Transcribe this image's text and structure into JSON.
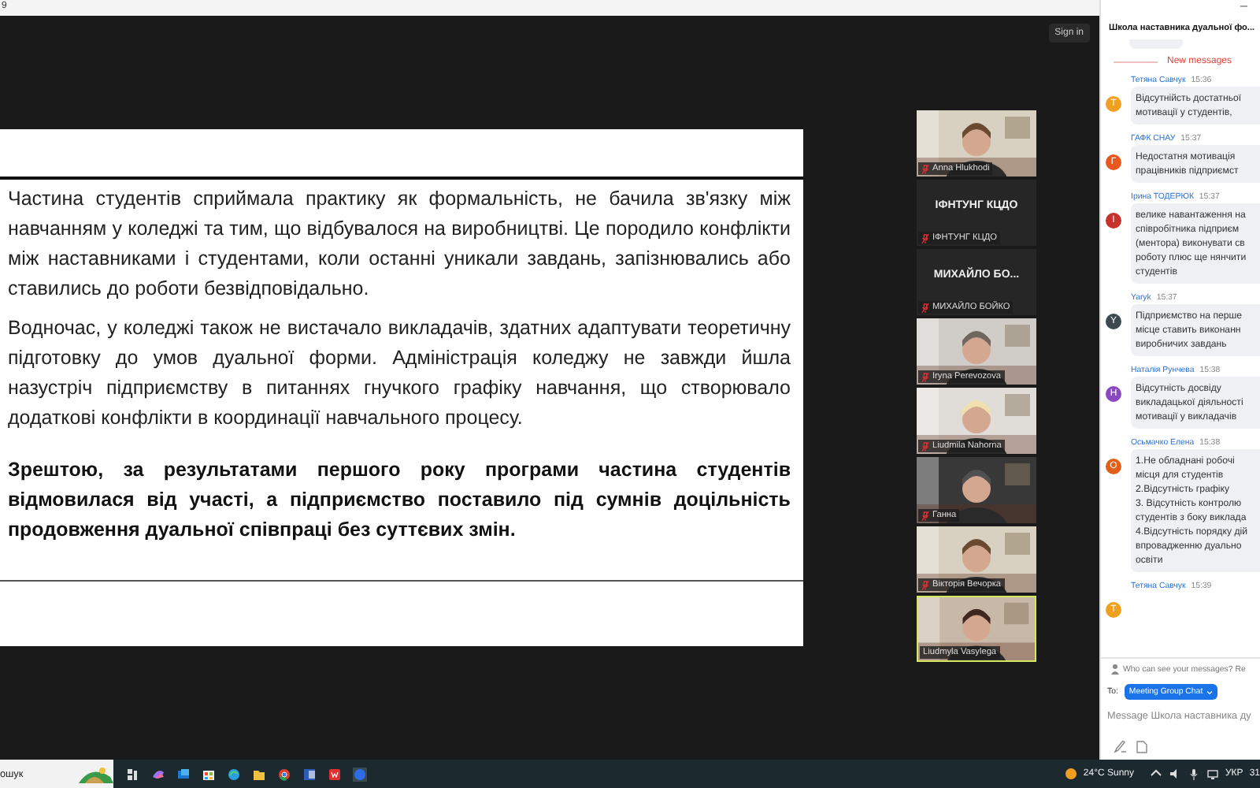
{
  "corner_text": "9",
  "sign_in": "Sign in",
  "slide": {
    "paragraphs": [
      {
        "text": "Частина студентів сприймала практику як формальність, не бачила зв'язку між навчанням у коледжі та тим, що відбувалося на виробництві. Це породило конфлікти між наставниками і студентами, коли останні уникали завдань, запізнювались або ставились до роботи безвідповідально.",
        "bold": false
      },
      {
        "text": "Водночас, у коледжі також не вистачало викладачів, здатних адаптувати теоретичну підготовку до умов дуальної форми. Адміністрація коледжу не завжди йшла назустріч підприємству в питаннях гнучкого графіку навчання, що створювало додаткові конфлікти в координації навчального процесу.",
        "bold": false
      },
      {
        "text": "Зрештою, за результатами першого року програми частина студентів відмовилася від участі, а підприємство поставило під сумнів доцільність продовження дуальної співпраці без суттєвих змін.",
        "bold": true
      }
    ]
  },
  "participants": [
    {
      "kind": "video",
      "name": "Anna Hlukhodi",
      "muted": true,
      "speaking": false
    },
    {
      "kind": "name",
      "display": "ІФНТУНГ КЦДО",
      "name": "ІФНТУНГ КЦДО",
      "muted": true,
      "speaking": false
    },
    {
      "kind": "name",
      "display": "МИХАЙЛО БО...",
      "name": "МИХАЙЛО БОЙКО",
      "muted": true,
      "speaking": false
    },
    {
      "kind": "video",
      "name": "Iryna Perevozova",
      "muted": true,
      "speaking": false
    },
    {
      "kind": "video",
      "name": "Liudmila Nahorna",
      "muted": true,
      "speaking": false
    },
    {
      "kind": "video",
      "name": "Ганна",
      "muted": true,
      "speaking": false
    },
    {
      "kind": "video",
      "name": "Вікторія Вечорка",
      "muted": true,
      "speaking": false
    },
    {
      "kind": "video",
      "name": "Liudmyla Vasylega",
      "muted": false,
      "speaking": true
    }
  ],
  "chat": {
    "minimize": "–",
    "title": "Школа наставника дуальної фо...",
    "divider": "New messages",
    "messages": [
      {
        "sender": "Тетяна Савчук",
        "time": "15:36",
        "initial": "T",
        "color": "#f0a020",
        "lines": [
          "Відсутнійсть достатньої",
          "мотивації у студентів,"
        ]
      },
      {
        "sender": "ГАФК СНАУ",
        "time": "15:37",
        "initial": "Г",
        "color": "#e8581c",
        "lines": [
          "Недостатня мотивація",
          "працівників підприємст"
        ]
      },
      {
        "sender": "Ірина ТОДЕРЮК",
        "time": "15:37",
        "initial": "І",
        "color": "#c8322c",
        "lines": [
          "велике навантаження на",
          "співробітника підприєм",
          "(ментора) виконувати св",
          "роботу плюс ще нянчити",
          "студентів"
        ]
      },
      {
        "sender": "Yaryk",
        "time": "15:37",
        "initial": "Y",
        "color": "#3c4a50",
        "lines": [
          "Підприємство на перше",
          "місце ставить виконанн",
          "виробничих завдань"
        ]
      },
      {
        "sender": "Наталія Рунчева",
        "time": "15:38",
        "initial": "Н",
        "color": "#8a48c0",
        "lines": [
          "Відсутність досвіду",
          "викладацької діяльності",
          "мотивації у викладачів"
        ]
      },
      {
        "sender": "Осьмачко Елена",
        "time": "15:38",
        "initial": "О",
        "color": "#e0601a",
        "lines": [
          "1.Не обладнані робочі",
          "місця для студентів",
          "2.Відсутність графіку",
          "3. Відсутність контролю",
          "студентів з боку виклада",
          "4.Відсутність порядку дій",
          "впровадженню дуально",
          "освіти"
        ]
      },
      {
        "sender": "Тетяна Савчук",
        "time": "15:39",
        "initial": "T",
        "color": "#f0a020"
      }
    ],
    "privacy": "Who can see your messages? Re",
    "to_label": "To:",
    "recipient": "Meeting Group Chat",
    "placeholder": "Message Школа наставника ду"
  },
  "taskbar": {
    "search": "ошук",
    "weather": "24°C  Sunny",
    "language": "УКР",
    "clock": "31"
  }
}
